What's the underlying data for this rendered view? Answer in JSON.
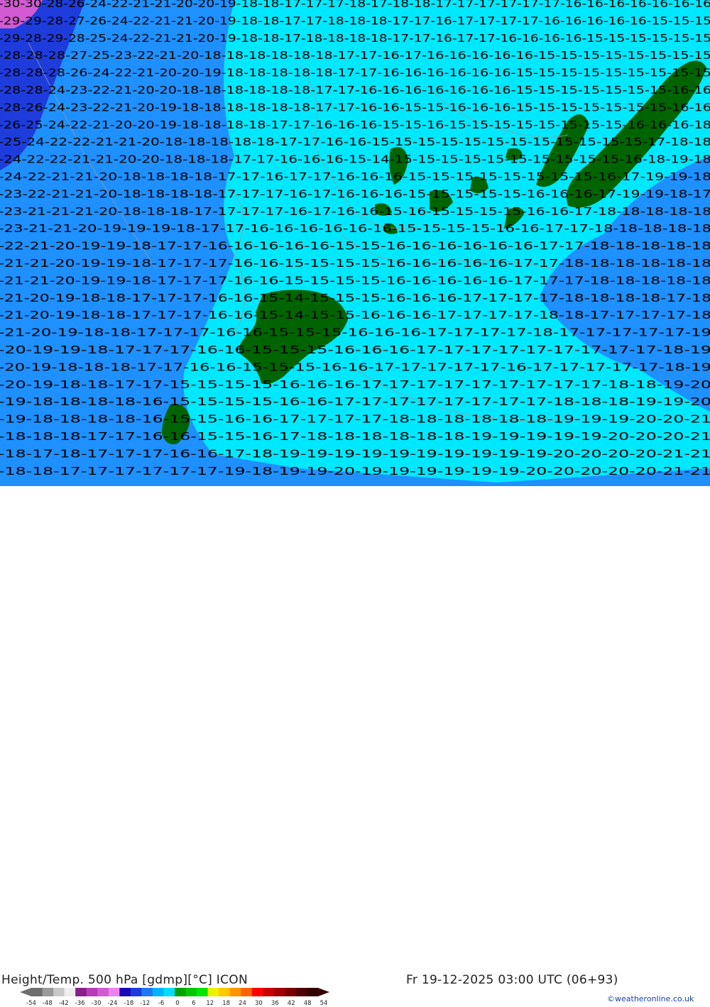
{
  "title": "Height/Temp. 500 hPa [gdmp][°C] ICON",
  "valid_time": "Fr 19-12-2025 03:00 UTC (06+93)",
  "credit": "©weatheronline.co.uk",
  "colors": {
    "land_mask": "#006400",
    "cyan_band": "#00e8ff",
    "blue_band": "#1e90ff",
    "deep_blue": "#0000cd",
    "contour_text": "#000000",
    "border": "#9a9a9a"
  },
  "color_scale": {
    "labels": [
      "-54",
      "-48",
      "-42",
      "-36",
      "-30",
      "-24",
      "-18",
      "-12",
      "-6",
      "0",
      "6",
      "12",
      "18",
      "24",
      "30",
      "36",
      "42",
      "48",
      "54"
    ],
    "colors": [
      "#6e6e6e",
      "#9a9a9a",
      "#c8c8c8",
      "#eeeeee",
      "#8a1e8a",
      "#b63cb6",
      "#d25ad2",
      "#ee82ee",
      "#1a0ab4",
      "#1e3cdc",
      "#1e78f0",
      "#00b4ff",
      "#00dcff",
      "#00a000",
      "#00c800",
      "#00e600",
      "#f0f000",
      "#ffc800",
      "#ff9600",
      "#ff6400",
      "#ff0000",
      "#c80000",
      "#a00000",
      "#780000",
      "#500000",
      "#320000"
    ]
  },
  "map": {
    "contour_rows": [
      "-30-30-28-26-24-22-21-21-20-20-19-18-18-17-17-17-18-17-18-18-17-17-17-17-17-17-16-16-16-16-16-16-16",
      "-29-29-28-27-26-24-22-21-21-20-19-18-18-17-17-18-18-18-17-17-16-17-17-17-17-16-16-16-16-16-15-15-15",
      "-29-28-29-28-25-24-22-21-21-20-19-18-18-17-18-18-18-18-17-17-16-17-17-16-16-16-16-15-15-15-15-15-15",
      "-28-28-28-27-25-23-22-21-20-18-18-18-18-18-18-17-17-16-17-16-16-16-16-16-15-15-15-15-15-15-15-15",
      "-28-28-28-26-24-22-21-20-20-19-18-18-18-18-18-17-17-16-16-16-16-16-16-15-15-15-15-15-15-15-15-15",
      "-28-28-24-23-22-21-20-20-18-18-18-18-18-18-17-17-16-16-16-16-16-16-16-15-15-15-15-15-15-15-16-16",
      "-28-26-24-23-22-21-20-19-18-18-18-18-18-18-17-17-16-16-15-15-16-16-16-15-15-15-15-15-15-15-16-16",
      "-26-25-24-22-21-20-20-19-18-18-18-18-17-17-16-16-16-15-15-16-15-15-15-15-15-15-15-15-16-16-16-18",
      "-25-24-22-22-21-21-20-18-18-18-18-18-17-17-16-16-15-15-15-15-15-15-15-15-15-15-15-15-17-18-18",
      "-24-22-22-21-21-20-20-18-18-18-17-17-16-16-16-15-14-15-15-15-15-15-15-15-15-15-15-16-18-19-18",
      "-24-22-21-21-20-18-18-18-18-17-17-16-17-17-16-16-16-15-15-15-15-15-15-15-15-16-17-19-19-18",
      "-23-22-21-21-20-18-18-18-18-17-17-17-16-17-16-16-16-15-15-15-15-15-16-16-16-17-19-19-18-17",
      "-23-21-21-21-20-18-18-18-17-17-17-17-16-17-16-16-15-16-15-15-15-15-16-16-17-18-18-18-18-18",
      "-23-21-21-20-19-19-19-18-17-17-16-16-16-16-16-16-15-15-15-15-16-16-17-17-18-18-18-18-18",
      "-22-21-20-19-19-18-17-17-16-16-16-16-16-15-15-16-16-16-16-16-16-17-17-18-18-18-18-18",
      "-21-21-20-19-19-18-17-17-17-16-16-15-15-15-15-16-16-16-16-16-17-17-18-18-18-18-18-18",
      "-21-21-20-19-19-18-17-17-17-16-16-15-15-15-15-16-16-16-16-16-17-17-17-18-18-18-18-18",
      "-21-20-19-18-18-17-17-17-16-16-15-14-15-15-15-16-16-16-17-17-17-17-18-18-18-18-17-18",
      "-21-20-19-18-18-17-17-17-16-16-15-14-15-15-16-16-16-17-17-17-17-18-18-17-17-17-17-18",
      "-21-20-19-18-18-17-17-17-16-16-15-15-15-16-16-16-17-17-17-17-18-17-17-17-17-17-19",
      "-20-19-19-18-17-17-17-16-16-15-15-15-16-16-16-17-17-17-17-17-17-17-17-17-18-19",
      "-20-19-18-18-18-17-17-16-16-15-15-15-16-16-17-17-17-17-17-16-17-17-17-17-17-18-19",
      "-20-19-18-18-17-17-15-15-15-15-16-16-16-17-17-17-17-17-17-17-17-17-18-18-19-20",
      "-19-18-18-18-18-16-15-15-15-15-16-16-17-17-17-17-17-17-17-17-18-18-18-19-19-20",
      "-19-18-18-18-18-16-15-15-16-16-17-17-17-17-18-18-18-18-18-18-19-19-19-20-20-21",
      "-18-18-18-17-17-16-16-15-15-16-17-18-18-18-18-18-18-19-19-19-19-19-20-20-20-21",
      "-18-17-18-17-17-17-16-16-17-18-19-19-19-19-19-19-19-19-19-19-20-20-20-20-21-21",
      "-18-18-17-17-17-17-17-17-19-18-19-19-20-19-19-19-19-19-19-20-20-20-20-20-21-21"
    ]
  }
}
